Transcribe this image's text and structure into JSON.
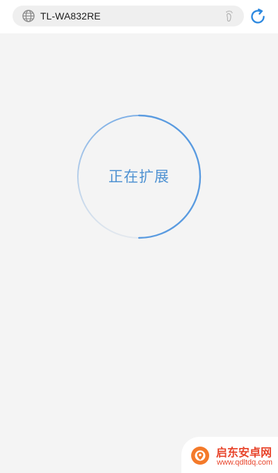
{
  "browser": {
    "url": "TL-WA832RE",
    "icons": {
      "left": "globe-icon",
      "right": "footprint-icon",
      "reload": "refresh-icon"
    },
    "colors": {
      "accent": "#2f8ae0",
      "bar_bg": "#ffffff",
      "pill_bg": "#efefef"
    }
  },
  "main": {
    "status_text": "正在扩展",
    "progress_icon": "loading-ring",
    "colors": {
      "ring": "#5a9be0",
      "text": "#4f92d2",
      "background": "#f4f4f4"
    }
  },
  "watermark": {
    "title": "启东安卓网",
    "url": "www.qdltdq.com",
    "colors": {
      "brand": "#e8452c"
    }
  }
}
